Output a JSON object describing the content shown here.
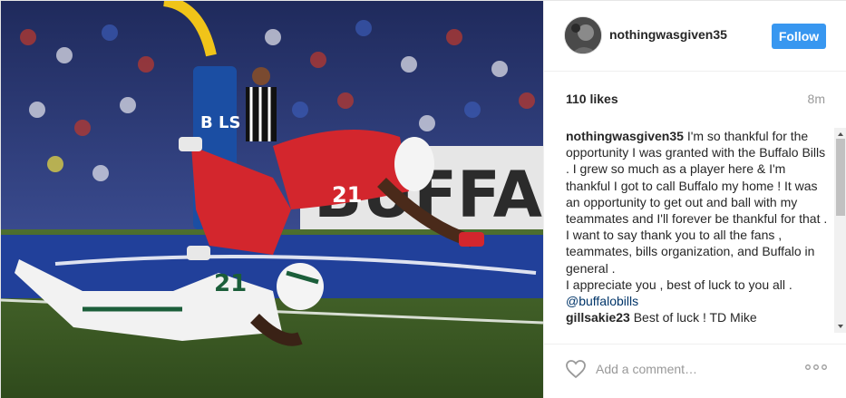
{
  "post": {
    "photo": {
      "signage": "BUFFALO",
      "pylon_letters": "B  LS",
      "player_one_number": "21",
      "player_two_number": "21"
    },
    "header": {
      "username": "nothingwasgiven35",
      "follow_label": "Follow",
      "follow_color": "#3897f0"
    },
    "stats": {
      "likes": "110 likes",
      "time_ago": "8m"
    },
    "comments": [
      {
        "user": "nothingwasgiven35",
        "text": "I'm so thankful for the opportunity I was granted with the Buffalo Bills . I grew so much as a player here & I'm thankful I got to call Buffalo my home ! It was an opportunity to get out and ball with my teammates and I'll forever be thankful for that . I want to say thank you to all the fans , teammates, bills organization, and Buffalo in general .\nI appreciate you , best of luck to you all .",
        "mention": "@buffalobills"
      },
      {
        "user": "gillsakie23",
        "text": "Best of luck ! TD Mike"
      }
    ],
    "footer": {
      "comment_placeholder": "Add a comment…",
      "heart_icon": "heart-outline-icon",
      "more_icon": "more-options-icon"
    }
  }
}
